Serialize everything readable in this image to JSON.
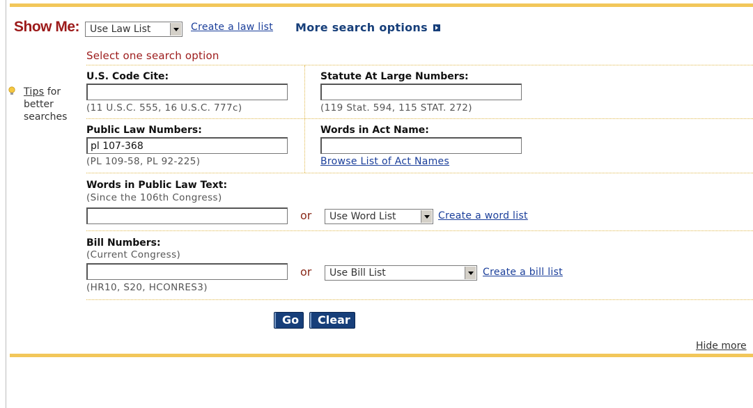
{
  "header": {
    "show_me_label": "Show Me:",
    "law_list_select": "Use Law List",
    "create_law_list": "Create a law list",
    "more_search_options": "More search options"
  },
  "form": {
    "title": "Select one search option",
    "us_code": {
      "label": "U.S. Code Cite:",
      "value": "",
      "hint": "(11 U.S.C. 555, 16 U.S.C. 777c)"
    },
    "statute": {
      "label": "Statute At Large Numbers:",
      "value": "",
      "hint": "(119 Stat. 594, 115 STAT. 272)"
    },
    "public_law": {
      "label": "Public Law Numbers:",
      "value": "pl 107-368",
      "hint": "(PL 109-58, PL 92-225)"
    },
    "act_name": {
      "label": "Words in Act Name:",
      "value": "",
      "browse_link": "Browse List of Act Names"
    },
    "law_text": {
      "label": "Words in Public Law Text:",
      "sublabel": "(Since the 106th Congress)",
      "value": "",
      "or": "or",
      "word_list_select": "Use Word List",
      "create_word_list": "Create a word list"
    },
    "bill": {
      "label": "Bill Numbers:",
      "sublabel": "(Current Congress)",
      "value": "",
      "or": "or",
      "bill_list_select": "Use Bill List",
      "create_bill_list": "Create a bill list",
      "hint": "(HR10, S20, HCONRES3)"
    },
    "go_button": "Go",
    "clear_button": "Clear"
  },
  "tips": {
    "link": "Tips",
    "line1_rest": " for",
    "line2": "better",
    "line3": "searches"
  },
  "footer": {
    "hide_more": "Hide more"
  },
  "colors": {
    "accent_bar": "#f2c75a",
    "show_me_red": "#9c1a1a",
    "link_blue": "#1a3e9a",
    "button_navy": "#173f7a"
  }
}
